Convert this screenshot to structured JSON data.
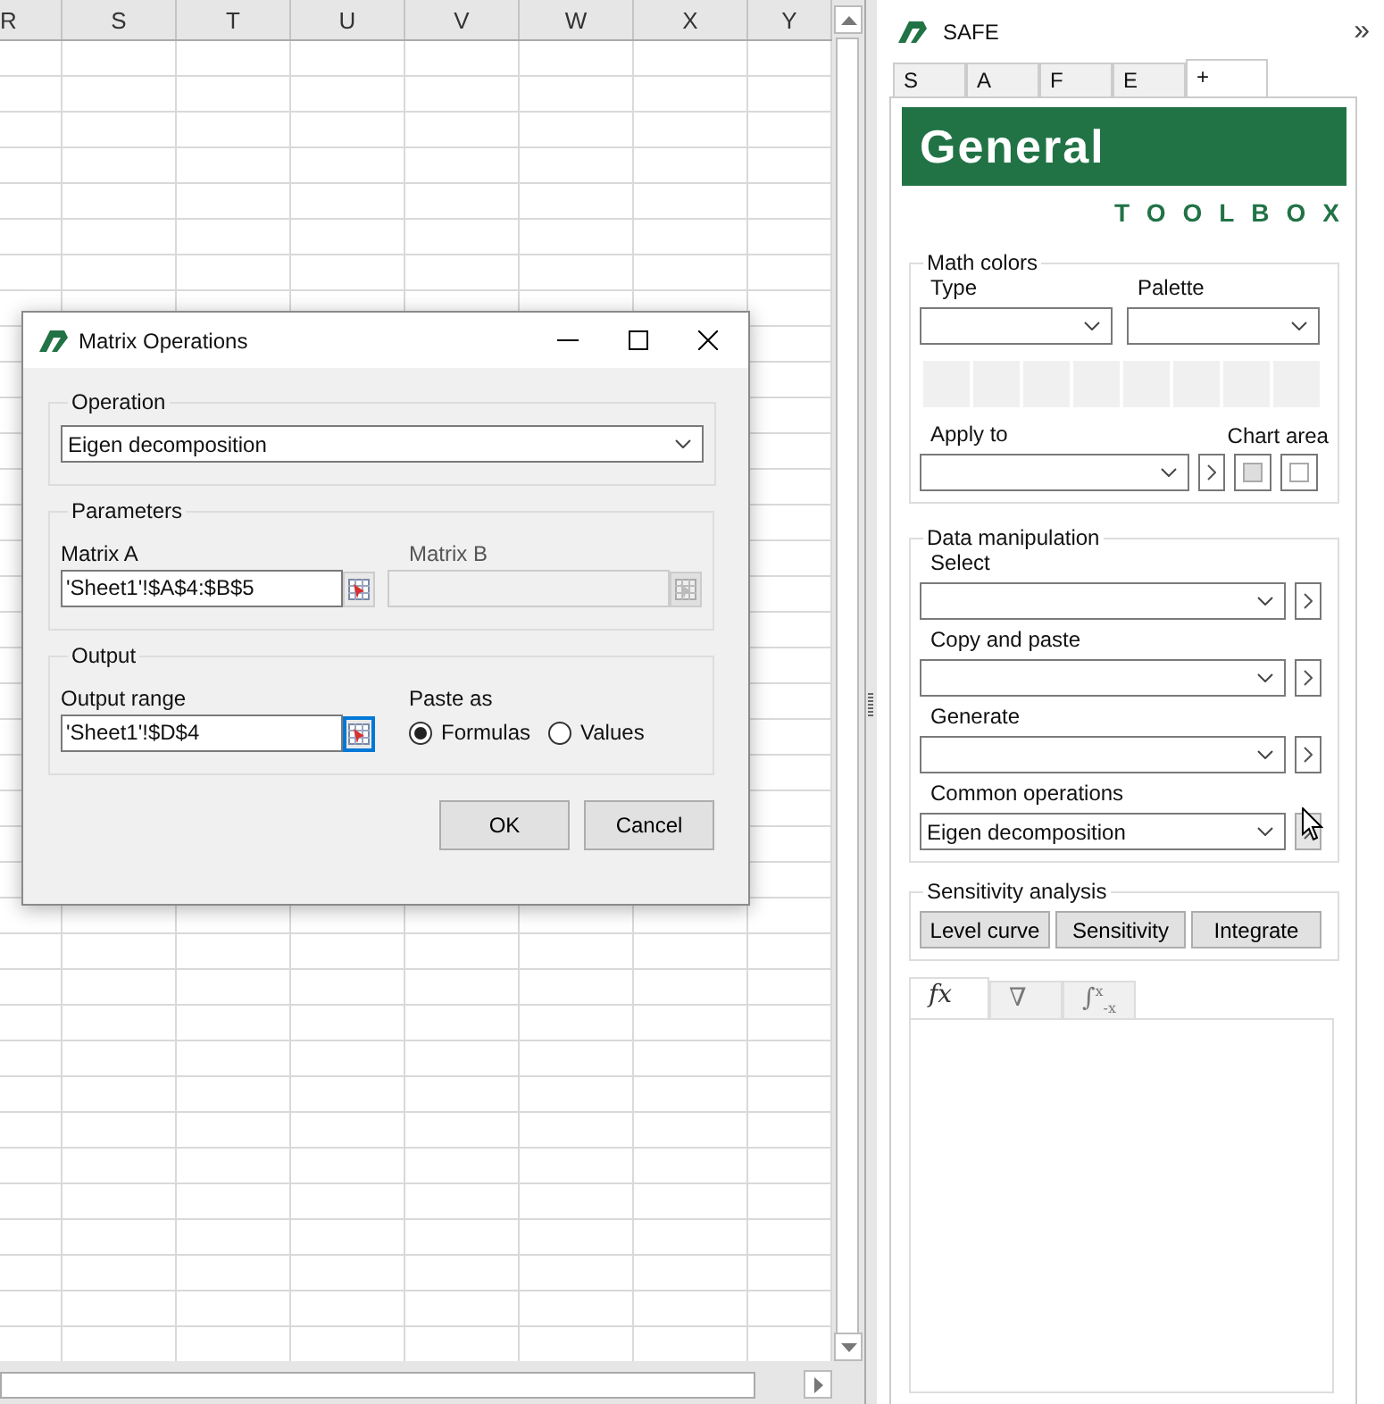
{
  "spreadsheet": {
    "column_headers": [
      "R",
      "S",
      "T",
      "U",
      "V",
      "W",
      "X",
      "Y"
    ]
  },
  "dialog": {
    "title": "Matrix Operations",
    "operation": {
      "label": "Operation",
      "value": "Eigen decomposition"
    },
    "parameters": {
      "label": "Parameters",
      "matrix_a": {
        "label": "Matrix A",
        "value": "'Sheet1'!$A$4:$B$5",
        "disabled": false
      },
      "matrix_b": {
        "label": "Matrix B",
        "disabled": true
      }
    },
    "output": {
      "label": "Output",
      "range": {
        "label": "Output range",
        "value": "'Sheet1'!$D$4",
        "focused": true
      },
      "paste_as": {
        "label": "Paste as",
        "options": [
          {
            "label": "Formulas",
            "selected": true
          },
          {
            "label": "Values",
            "selected": false
          }
        ]
      }
    },
    "buttons": [
      "OK",
      "Cancel"
    ]
  },
  "panel": {
    "title": "SAFE",
    "collapse": "»",
    "tabs": [
      {
        "label": "S",
        "selected": false
      },
      {
        "label": "A",
        "selected": false
      },
      {
        "label": "F",
        "selected": false
      },
      {
        "label": "E",
        "selected": false
      },
      {
        "label": "+",
        "selected": true
      }
    ],
    "banner": {
      "title": "General",
      "subtitle": "TOOLBOX"
    },
    "math_colors": {
      "label": "Math colors",
      "type_label": "Type",
      "palette_label": "Palette",
      "swatches": [
        {
          "color": "#f0f0f0"
        },
        {
          "color": "#f0f0f0"
        },
        {
          "color": "#f0f0f0"
        },
        {
          "color": "#f0f0f0"
        },
        {
          "color": "#f0f0f0"
        },
        {
          "color": "#f0f0f0"
        },
        {
          "color": "#f0f0f0"
        },
        {
          "color": "#f0f0f0"
        }
      ],
      "apply_label": "Apply to",
      "chart_label": "Chart area"
    },
    "data_manipulation": {
      "label": "Data manipulation",
      "rows": [
        {
          "label": "Select"
        },
        {
          "label": "Copy and paste"
        },
        {
          "label": "Generate"
        },
        {
          "label": "Common operations",
          "value": "Eigen decomposition"
        }
      ]
    },
    "sensitivity": {
      "label": "Sensitivity analysis",
      "buttons": [
        "Level curve",
        "Sensitivity",
        "Integrate"
      ]
    },
    "formula_tabs": [
      {
        "label": "fx",
        "kind": "italic",
        "selected": true
      },
      {
        "label": "∇",
        "kind": "plain",
        "selected": false
      },
      {
        "label": "∫$^{x}$$_{-x}$",
        "kind": "rich",
        "selected": false
      }
    ]
  }
}
